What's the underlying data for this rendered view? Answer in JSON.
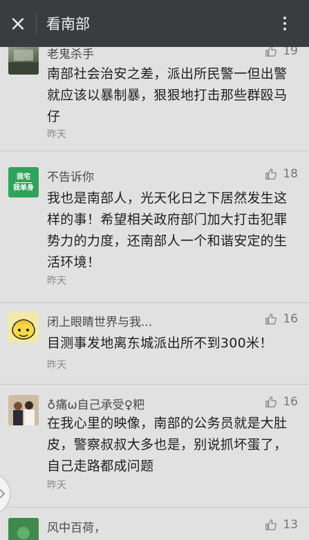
{
  "header": {
    "title": "看南部",
    "close_icon": "×"
  },
  "comments": [
    {
      "nickname": "老鬼杀手",
      "likes": "19",
      "text": "南部社会治安之差，派出所民警一但出警就应该以暴制暴，狠狠地打击那些群殴马仔",
      "time": "昨天",
      "avatar_colors": [
        "#8a9a84",
        "#3f4a3c"
      ]
    },
    {
      "nickname": "不告诉你",
      "likes": "18",
      "text": "我也是南部人，光天化日之下居然发生这样的事！希望相关政府部门加大打击犯罪势力的力度，还南部人一个和谐安定的生活环境！",
      "time": "昨天",
      "avatar_text_top": "我宅",
      "avatar_text_bottom": "我单身",
      "avatar_colors": [
        "#2fa35b",
        "#ffffff"
      ]
    },
    {
      "nickname": "闭上眼睛世界与我...",
      "likes": "16",
      "text": "目测事发地离东城派出所不到300米！",
      "time": "昨天",
      "avatar_colors": [
        "#f1d84b",
        "#222222"
      ]
    },
    {
      "nickname": "♁痛ω自己承受♀粑",
      "likes": "16",
      "text": "在我心里的映像，南部的公务员就是大肚皮，警察叔叔大多也是，别说抓坏蛋了，自己走路都成问题",
      "time": "昨天",
      "avatar_colors": [
        "#c9b8a0",
        "#5a2a2a"
      ]
    },
    {
      "nickname": "风中百荷，",
      "likes": "13",
      "text": "",
      "time": "",
      "avatar_colors": [
        "#3f8a4a",
        "#1c3d22"
      ]
    }
  ],
  "scroll_handle_icon": "chevron-right-icon"
}
